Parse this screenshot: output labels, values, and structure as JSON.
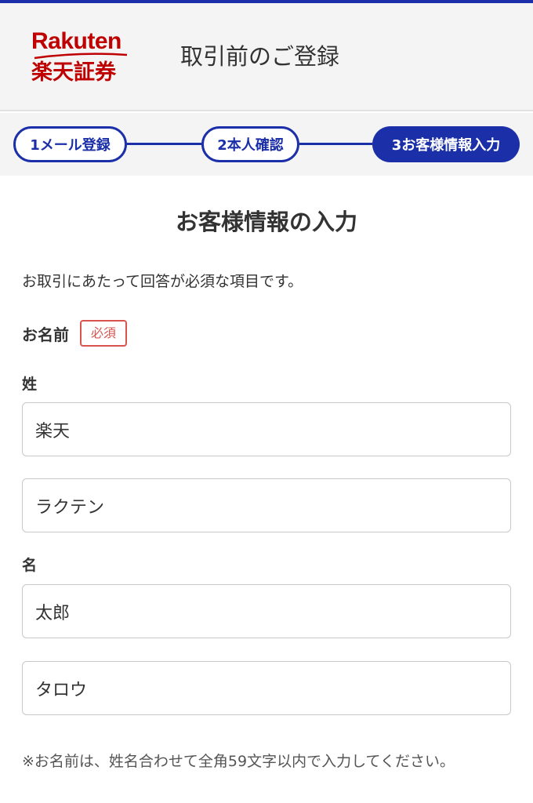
{
  "header": {
    "logo_en": "Rakuten",
    "logo_ja": "楽天証券",
    "title": "取引前のご登録"
  },
  "stepper": {
    "steps": [
      {
        "label": "1メール登録",
        "state": "done"
      },
      {
        "label": "2本人確認",
        "state": "done"
      },
      {
        "label": "3お客様情報入力",
        "state": "active"
      }
    ]
  },
  "form": {
    "title": "お客様情報の入力",
    "intro": "お取引にあたって回答が必須な項目です。",
    "name_label": "お名前",
    "required_badge": "必須",
    "last_name_label": "姓",
    "last_name_kanji": "楽天",
    "last_name_kana": "ラクテン",
    "first_name_label": "名",
    "first_name_kanji": "太郎",
    "first_name_kana": "タロウ",
    "note": "※お名前は、姓名合わせて全角59文字以内で入力してください。"
  },
  "colors": {
    "brand_red": "#bf0000",
    "accent_blue": "#1b2fa8",
    "required_red": "#d9534f"
  }
}
